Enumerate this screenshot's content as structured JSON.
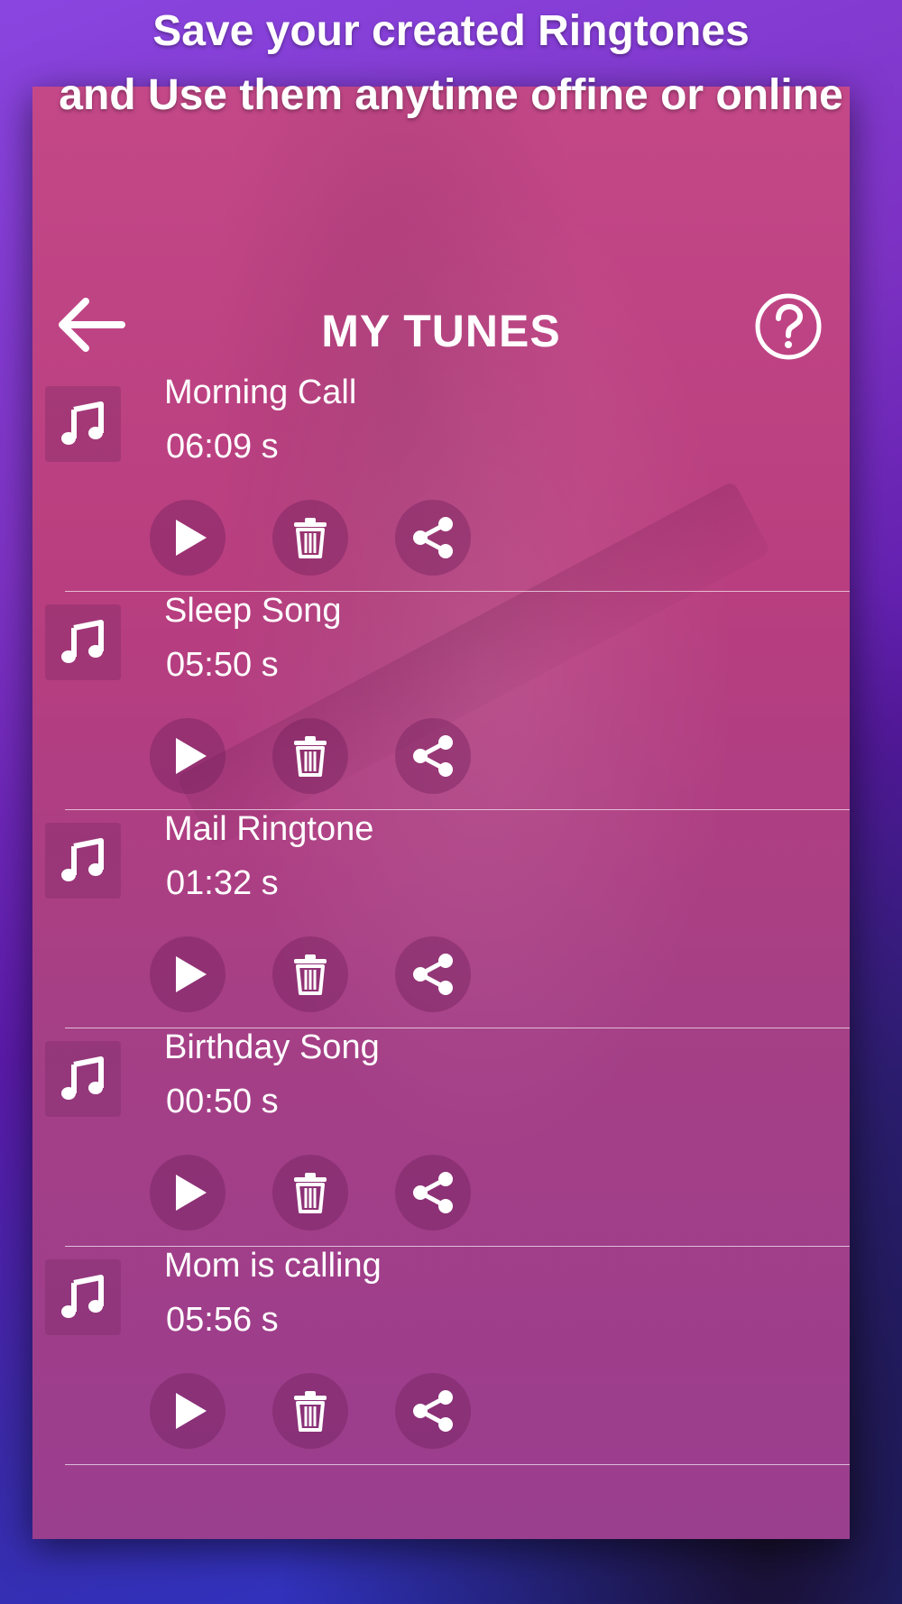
{
  "promo": {
    "line1": "Save your created Ringtones",
    "line2": "and Use them anytime offine or online"
  },
  "header": {
    "title": "MY TUNES",
    "back_icon": "arrow-left-icon",
    "help_icon": "question-circle-icon"
  },
  "tunes": [
    {
      "name": "Morning Call",
      "duration": "06:09 s"
    },
    {
      "name": "Sleep Song",
      "duration": "05:50 s"
    },
    {
      "name": "Mail Ringtone",
      "duration": "01:32 s"
    },
    {
      "name": "Birthday Song",
      "duration": "00:50 s"
    },
    {
      "name": "Mom is calling",
      "duration": "05:56 s"
    }
  ],
  "icons": {
    "thumb": "music-note-icon",
    "play": "play-icon",
    "delete": "trash-icon",
    "share": "share-icon"
  },
  "colors": {
    "accent": "#c44888",
    "background_top": "#8a45e0",
    "background_bottom": "#2a3ad0"
  }
}
